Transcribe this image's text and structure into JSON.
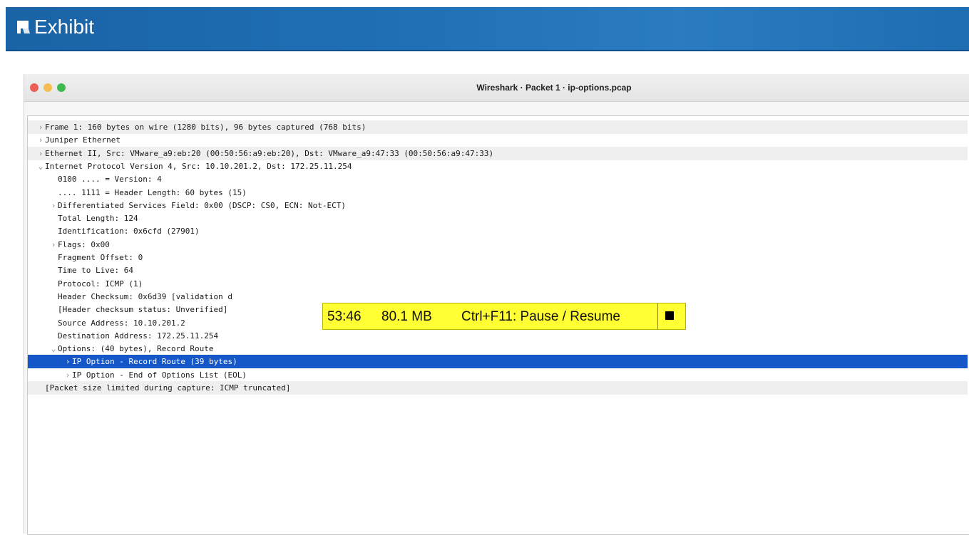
{
  "exhibit": {
    "title": "Exhibit",
    "icon": "exhibit-flag-icon",
    "colors": {
      "bar": "#1f6fb5",
      "text": "#ffffff"
    }
  },
  "window": {
    "title": "Wireshark · Packet 1 · ip-options.pcap",
    "traffic_lights": [
      "close",
      "minimize",
      "zoom"
    ]
  },
  "tree": {
    "rows": [
      {
        "text": "Frame 1: 160 bytes on wire (1280 bits), 96 bytes captured (768 bits)",
        "arrow": "›",
        "indent": 0,
        "state": "alt"
      },
      {
        "text": "Juniper Ethernet",
        "arrow": "›",
        "indent": 0,
        "state": ""
      },
      {
        "text": "Ethernet II, Src: VMware_a9:eb:20 (00:50:56:a9:eb:20), Dst: VMware_a9:47:33 (00:50:56:a9:47:33)",
        "arrow": "›",
        "indent": 0,
        "state": "alt"
      },
      {
        "text": "Internet Protocol Version 4, Src: 10.10.201.2, Dst: 172.25.11.254",
        "arrow": "⌄",
        "indent": 0,
        "state": ""
      },
      {
        "text": "0100 .... = Version: 4",
        "arrow": "",
        "indent": 1,
        "state": ""
      },
      {
        "text": ".... 1111 = Header Length: 60 bytes (15)",
        "arrow": "",
        "indent": 1,
        "state": ""
      },
      {
        "text": "Differentiated Services Field: 0x00 (DSCP: CS0, ECN: Not-ECT)",
        "arrow": "›",
        "indent": 1,
        "state": ""
      },
      {
        "text": "Total Length: 124",
        "arrow": "",
        "indent": 1,
        "state": ""
      },
      {
        "text": "Identification: 0x6cfd (27901)",
        "arrow": "",
        "indent": 1,
        "state": ""
      },
      {
        "text": "Flags: 0x00",
        "arrow": "›",
        "indent": 1,
        "state": ""
      },
      {
        "text": "Fragment Offset: 0",
        "arrow": "",
        "indent": 1,
        "state": ""
      },
      {
        "text": "Time to Live: 64",
        "arrow": "",
        "indent": 1,
        "state": ""
      },
      {
        "text": "Protocol: ICMP (1)",
        "arrow": "",
        "indent": 1,
        "state": ""
      },
      {
        "text": "Header Checksum: 0x6d39 [validation d",
        "arrow": "",
        "indent": 1,
        "state": ""
      },
      {
        "text": "[Header checksum status: Unverified]",
        "arrow": "",
        "indent": 1,
        "state": ""
      },
      {
        "text": "Source Address: 10.10.201.2",
        "arrow": "",
        "indent": 1,
        "state": ""
      },
      {
        "text": "Destination Address: 172.25.11.254",
        "arrow": "",
        "indent": 1,
        "state": ""
      },
      {
        "text": "Options: (40 bytes), Record Route",
        "arrow": "⌄",
        "indent": 1,
        "state": ""
      },
      {
        "text": "IP Option - Record Route (39 bytes)",
        "arrow": "›",
        "indent": 2,
        "state": "sel"
      },
      {
        "text": "IP Option - End of Options List (EOL)",
        "arrow": "›",
        "indent": 2,
        "state": ""
      },
      {
        "text": "[Packet size limited during capture: ICMP truncated]",
        "arrow": "",
        "indent": 0,
        "state": "alt"
      }
    ]
  },
  "recorder_overlay": {
    "time": "53:46",
    "memory": "80.1 MB",
    "hint": "Ctrl+F11: Pause / Resume",
    "stop_icon": "stop-icon",
    "color": "#ffff33"
  }
}
